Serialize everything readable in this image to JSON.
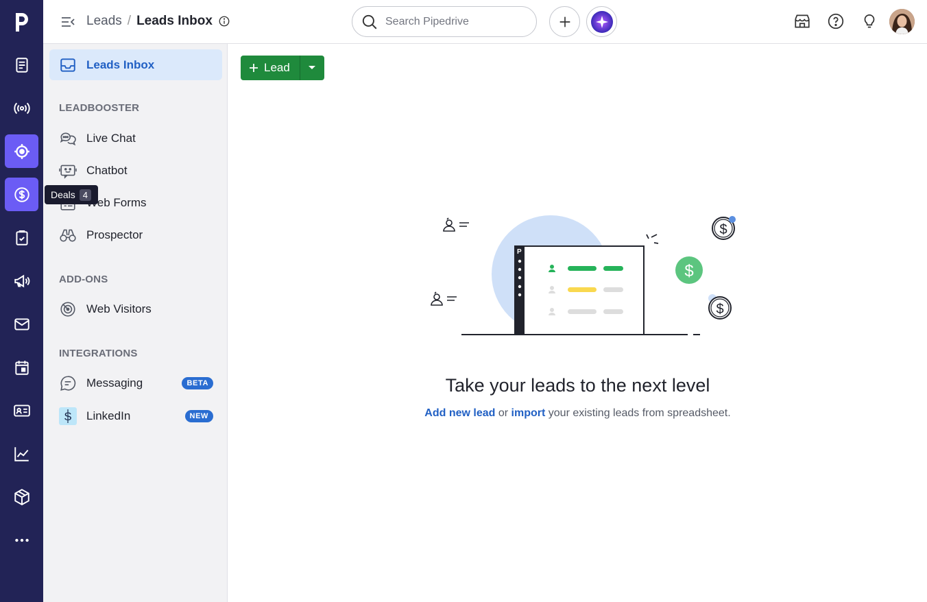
{
  "topbar": {
    "breadcrumb_parent": "Leads",
    "breadcrumb_separator": "/",
    "breadcrumb_current": "Leads Inbox",
    "search_placeholder": "Search Pipedrive"
  },
  "rail": {
    "logo_letter": "p",
    "items": [
      {
        "icon": "notes-icon"
      },
      {
        "icon": "broadcast-icon"
      },
      {
        "icon": "target-icon",
        "active": true
      },
      {
        "icon": "dollar-icon",
        "active": true
      },
      {
        "icon": "clipboard-icon"
      },
      {
        "icon": "megaphone-icon"
      },
      {
        "icon": "mail-icon"
      },
      {
        "icon": "calendar-icon"
      },
      {
        "icon": "contact-card-icon"
      },
      {
        "icon": "chart-icon"
      },
      {
        "icon": "box-icon"
      },
      {
        "icon": "more-icon"
      }
    ],
    "tooltip_label": "Deals",
    "tooltip_count": "4"
  },
  "sidebar": {
    "leads_inbox": "Leads Inbox",
    "leadbooster_label": "LEADBOOSTER",
    "live_chat": "Live Chat",
    "chatbot": "Chatbot",
    "web_forms": "Web Forms",
    "prospector": "Prospector",
    "addons_label": "ADD-ONS",
    "web_visitors": "Web Visitors",
    "integrations_label": "INTEGRATIONS",
    "messaging": "Messaging",
    "messaging_badge": "BETA",
    "linkedin": "LinkedIn",
    "linkedin_badge": "NEW"
  },
  "main": {
    "add_lead_label": "Lead",
    "empty_title": "Take your leads to the next level",
    "empty_link_add": "Add new lead",
    "empty_or": " or ",
    "empty_link_import": "import",
    "empty_rest": " your existing leads from spreadsheet."
  },
  "colors": {
    "rail_bg": "#222356",
    "rail_active": "#6b5cf5",
    "primary_green": "#1f8a3c",
    "link_blue": "#2160c4",
    "sidebar_bg": "#f2f2f4",
    "active_item_bg": "#dbe9fb"
  }
}
